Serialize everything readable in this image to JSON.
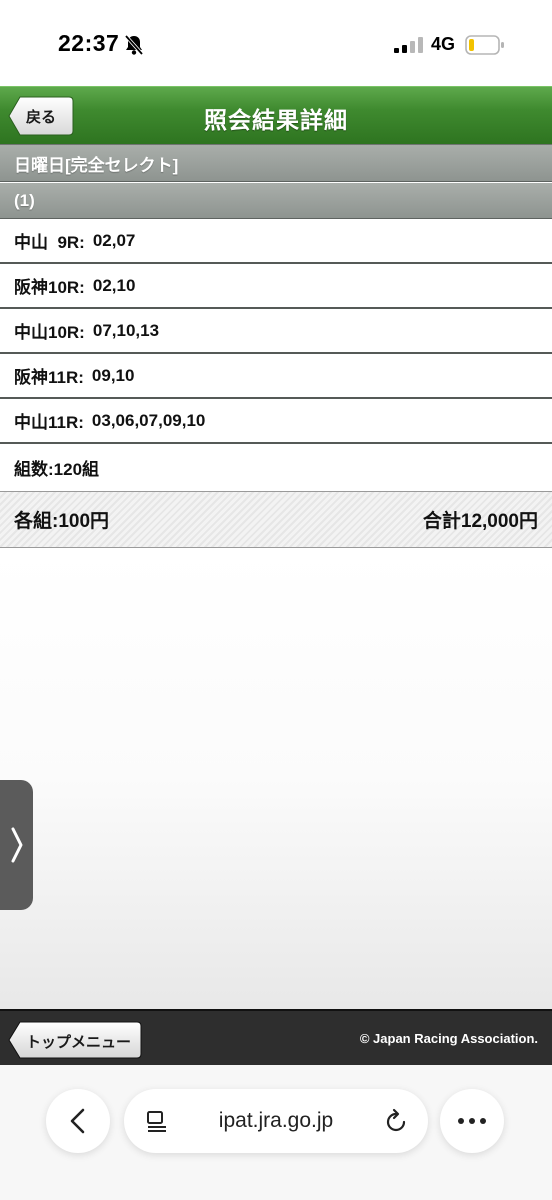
{
  "status_bar": {
    "time": "22:37",
    "network": "4G",
    "bell_icon": "bell-slash-icon",
    "signal_icon": "signal-bars-icon",
    "battery_icon": "battery-low-icon"
  },
  "header": {
    "back_label": "戻る",
    "title": "照会結果詳細",
    "color": "#3f8a2f"
  },
  "section": {
    "day_label": "日曜日[完全セレクト]",
    "number_label": "(1)"
  },
  "rows": [
    {
      "race": "中山  9R:",
      "horses": "02,07"
    },
    {
      "race": "阪神10R:",
      "horses": "02,10"
    },
    {
      "race": "中山10R:",
      "horses": "07,10,13"
    },
    {
      "race": "阪神11R:",
      "horses": "09,10"
    },
    {
      "race": "中山11R:",
      "horses": "03,06,07,09,10"
    }
  ],
  "combination_count": "組数:120組",
  "totals": {
    "per_unit": "各組:100円",
    "total": "合計12,000円"
  },
  "footer": {
    "top_menu_label": "トップメニュー",
    "copyright": "© Japan Racing Association."
  },
  "browser": {
    "url": "ipat.jra.go.jp",
    "back_icon": "chevron-left-icon",
    "reader_icon": "page-menu-icon",
    "reload_icon": "reload-icon",
    "more_icon": "ellipsis-icon"
  },
  "side_handle_icon": "chevron-right-icon"
}
